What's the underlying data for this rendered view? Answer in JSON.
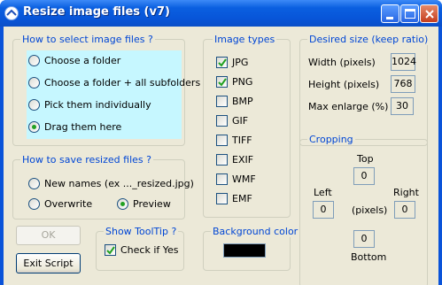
{
  "window": {
    "title": "Resize image files (v7)"
  },
  "select_group": {
    "label": "How to select image files ?",
    "options": [
      "Choose a folder",
      "Choose a folder + all subfolders",
      "Pick them individually",
      "Drag them here"
    ],
    "selected_index": 3
  },
  "save_group": {
    "label": "How to save resized files ?",
    "new_names": "New names (ex ..._resized.jpg)",
    "overwrite": "Overwrite",
    "preview": "Preview",
    "selected": "Preview"
  },
  "image_types": {
    "label": "Image types",
    "types": [
      "JPG",
      "PNG",
      "BMP",
      "GIF",
      "TIFF",
      "EXIF",
      "WMF",
      "EMF"
    ],
    "checked": [
      true,
      true,
      false,
      false,
      false,
      false,
      false,
      false
    ]
  },
  "size_group": {
    "label": "Desired size (keep ratio)",
    "width_label": "Width (pixels)",
    "width": "1024",
    "height_label": "Height (pixels)",
    "height": "768",
    "enlarge_label": "Max enlarge (%)",
    "enlarge": "30"
  },
  "cropping": {
    "label": "Cropping",
    "top_label": "Top",
    "top": "0",
    "left_label": "Left",
    "left": "0",
    "right_label": "Right",
    "right": "0",
    "bottom_label": "Bottom",
    "bottom": "0",
    "unit": "(pixels)"
  },
  "tooltip_group": {
    "label": "Show ToolTip ?",
    "check_label": "Check if Yes",
    "checked": true
  },
  "background_group": {
    "label": "Background color",
    "color": "#000000"
  },
  "buttons": {
    "ok": "OK",
    "exit": "Exit Script"
  }
}
